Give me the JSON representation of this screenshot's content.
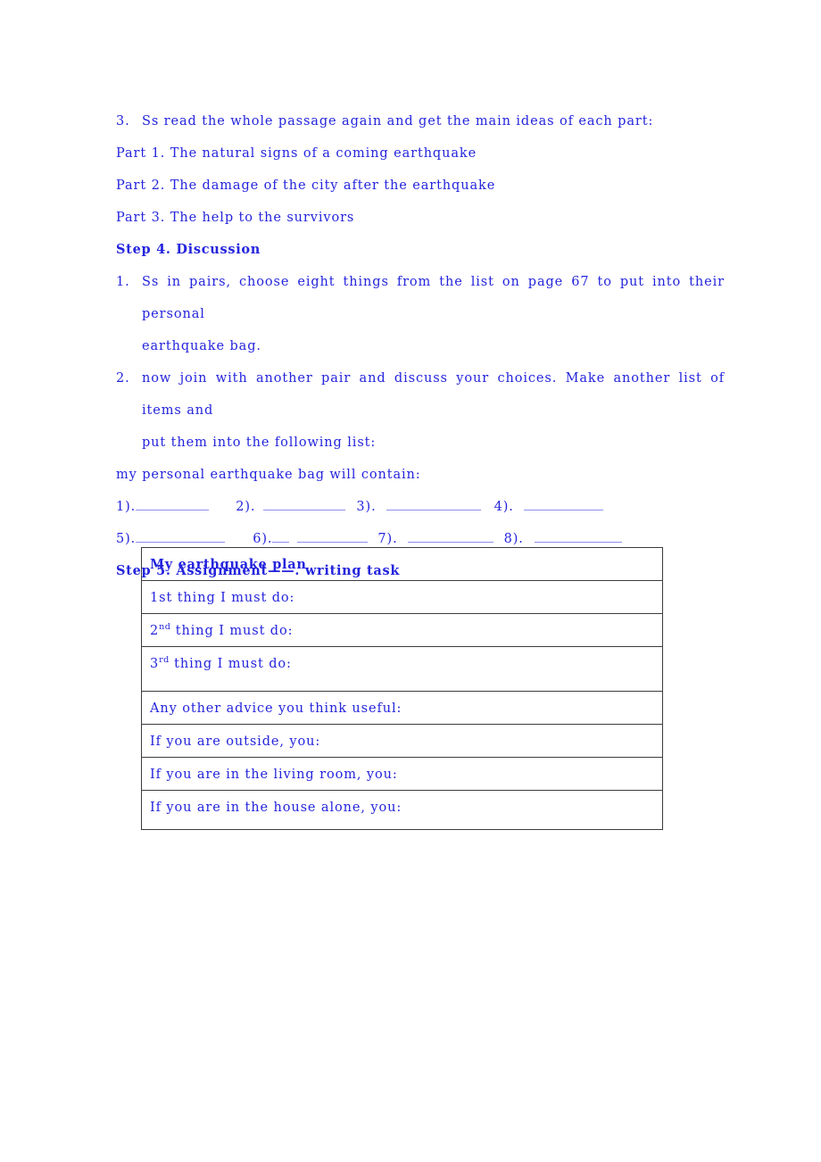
{
  "colors": {
    "text_blue": "#2424dd",
    "blank_blue": "#8d8dee",
    "table_border": "#3c3c3c",
    "page_bg": "#ffffff"
  },
  "document": {
    "intro_item": {
      "number": "3.",
      "text": "Ss read the whole passage again and get the main ideas of each part:"
    },
    "parts": [
      "Part 1. The natural signs of a coming earthquake",
      "Part 2. The damage of the city after the earthquake",
      "Part 3. The help to the survivors"
    ],
    "step4": {
      "heading": "Step 4. Discussion",
      "items": [
        {
          "number": "1.",
          "line1": "Ss in pairs, choose eight things from the list on page 67 to put into their personal",
          "line2": "earthquake bag."
        },
        {
          "number": "2.",
          "line1": "now join with another pair and discuss your choices. Make another list of items and",
          "line2": "put them into the following list:"
        }
      ],
      "bag_line": "my personal earthquake bag will contain:",
      "blanks_row1": [
        "1).",
        "2).",
        "3).",
        "4)."
      ],
      "blanks_row2": [
        "5).",
        "6).",
        "7).",
        "8)."
      ]
    },
    "step5": {
      "heading": "Step 5. Assignment——. writing task"
    },
    "plan_table": {
      "title": "My earthquake plan",
      "rows": [
        {
          "id": "title",
          "text": "My earthquake plan",
          "bold": true,
          "sup": "",
          "height": "header"
        },
        {
          "id": "thing1",
          "text": "1st thing I must do:",
          "bold": false,
          "sup": "",
          "height": "std"
        },
        {
          "id": "thing2",
          "prefix": "2",
          "sup": "nd",
          "text": " thing I must do:",
          "bold": false,
          "height": "std"
        },
        {
          "id": "thing3",
          "prefix": "3",
          "sup": "rd",
          "text": " thing I must do:",
          "bold": false,
          "height": "tall"
        },
        {
          "id": "advice",
          "text": "Any other advice you think useful:",
          "bold": false,
          "sup": "",
          "height": "std"
        },
        {
          "id": "outside",
          "text": "If you are outside, you:",
          "bold": false,
          "sup": "",
          "height": "std"
        },
        {
          "id": "living",
          "text": "If you are in the living room, you:",
          "bold": false,
          "sup": "",
          "height": "std"
        },
        {
          "id": "alone",
          "text": "If you are in the house alone, you:",
          "bold": false,
          "sup": "",
          "height": "last"
        }
      ]
    }
  }
}
